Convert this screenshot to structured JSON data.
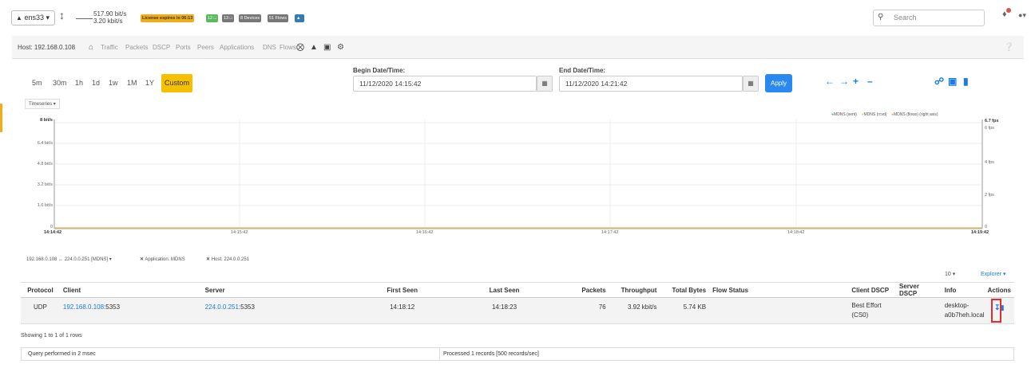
{
  "topbar": {
    "interface": "ens33",
    "rate_up": "517.90 bit/s",
    "rate_down": "3.20 kbit/s",
    "license": "License expires in 06:13",
    "badge_hosts_local": "12",
    "badge_hosts_remote": "13",
    "badge_devices": "8 Devices",
    "badge_flows": "51 Flows",
    "search_placeholder": "Search"
  },
  "colors": {
    "license": "#f0ad19",
    "green": "#5cb85c",
    "grey": "#777777",
    "blue": "#337ab7",
    "custom": "#f5c000",
    "apply": "#2a89f0"
  },
  "hostbar": {
    "host": "Host: 192.168.0.108",
    "links": [
      "Traffic",
      "Packets",
      "DSCP",
      "Ports",
      "Peers",
      "Applications",
      "DNS",
      "Flows"
    ]
  },
  "range": {
    "buttons": [
      "5m",
      "30m",
      "1h",
      "1d",
      "1w",
      "1M",
      "1Y",
      "Custom"
    ],
    "begin_label": "Begin Date/Time:",
    "begin_value": "11/12/2020 14:15:42",
    "end_label": "End Date/Time:",
    "end_value": "11/12/2020 14:21:42",
    "apply": "Apply"
  },
  "chart_data": {
    "type": "line",
    "selector": "Timeseries",
    "series": [
      {
        "name": "MDNS (sent)",
        "color": "#5cb85c"
      },
      {
        "name": "MDNS (rcvd)",
        "color": "#ffcc66"
      },
      {
        "name": "MDNS (flows) (right axis)",
        "color": "#ff9966"
      }
    ],
    "y_left_ticks": [
      "8 bit/s",
      "6.4 bit/s",
      "4.8 bit/s",
      "3.2 bit/s",
      "1.6 bit/s",
      "0"
    ],
    "y_right_ticks": [
      "6.7 fps",
      "6 fps",
      "4 fps",
      "2 fps",
      "0"
    ],
    "x_ticks": [
      "14:14:42",
      "14:15:42",
      "14:16:42",
      "14:17:42",
      "14:18:42",
      "14:19:42"
    ]
  },
  "filters": {
    "flow": "192.168.0.108 ↔ 224.0.0.251 [MDNS]",
    "app": "Application: MDNS",
    "host": "Host: 224.0.0.251"
  },
  "table": {
    "page_size": "10",
    "explorer": "Explorer",
    "headers": [
      "Protocol",
      "Client",
      "Server",
      "First Seen",
      "Last Seen",
      "Packets",
      "Throughput",
      "Total Bytes",
      "Flow Status",
      "Client DSCP",
      "Server DSCP",
      "Info",
      "Actions"
    ],
    "row": {
      "protocol": "UDP",
      "client_ip": "192.168.0.108",
      "client_port": ":5353",
      "server_ip": "224.0.0.251",
      "server_port": ":5353",
      "first_seen": "14:18:12",
      "last_seen": "14:18:23",
      "packets": "76",
      "throughput": "3.92 kbit/s",
      "total_bytes": "5.74 KB",
      "client_dscp": "Best Effort (CS0)",
      "info": "desktop-a0b7heh.local"
    },
    "showing": "Showing 1 to 1 of 1 rows"
  },
  "footer": {
    "query": "Query performed in 2 msec",
    "processed": "Processed 1 records [500 records/sec]"
  }
}
